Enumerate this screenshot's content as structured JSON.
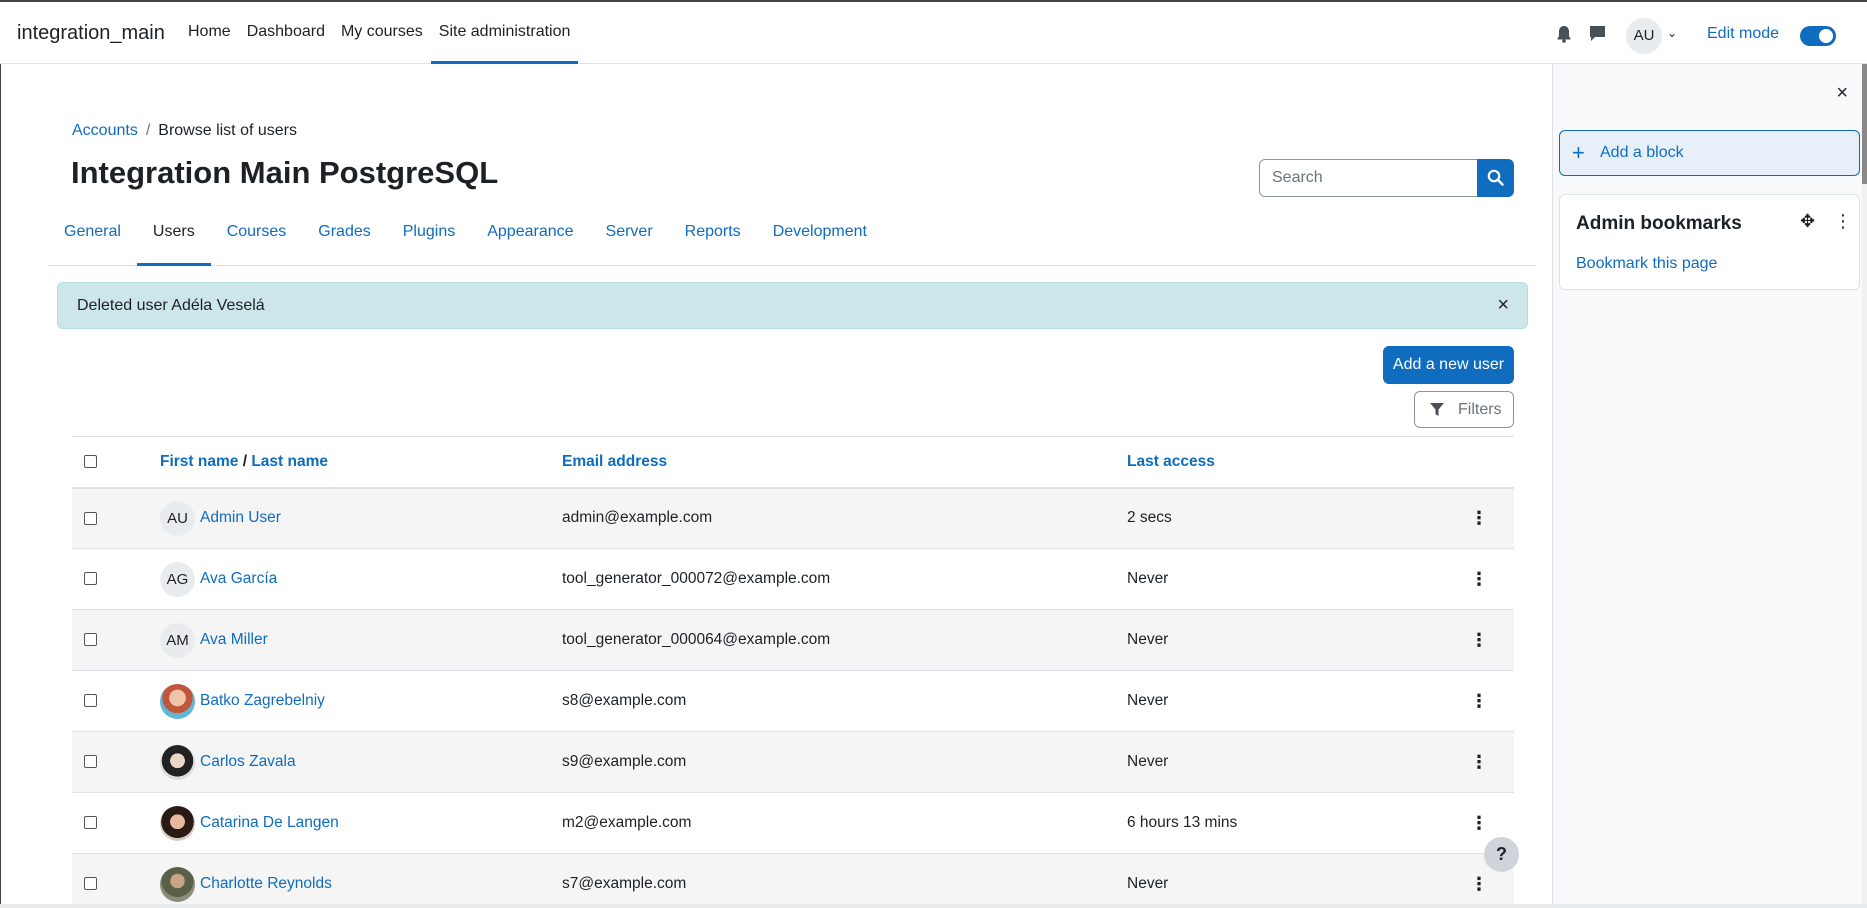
{
  "topbar": {
    "site_name": "integration_main",
    "nav": [
      {
        "label": "Home"
      },
      {
        "label": "Dashboard"
      },
      {
        "label": "My courses"
      },
      {
        "label": "Site administration"
      }
    ],
    "user_initials": "AU",
    "edit_mode_label": "Edit mode",
    "edit_mode_on": true
  },
  "breadcrumb": {
    "parent": "Accounts",
    "current": "Browse list of users"
  },
  "page_title": "Integration Main PostgreSQL",
  "search": {
    "placeholder": "Search"
  },
  "tabs": [
    {
      "label": "General"
    },
    {
      "label": "Users"
    },
    {
      "label": "Courses"
    },
    {
      "label": "Grades"
    },
    {
      "label": "Plugins"
    },
    {
      "label": "Appearance"
    },
    {
      "label": "Server"
    },
    {
      "label": "Reports"
    },
    {
      "label": "Development"
    }
  ],
  "alert": {
    "message": "Deleted user Adéla Veselá",
    "close": "×"
  },
  "actions": {
    "add_user": "Add a new user",
    "filters": "Filters"
  },
  "table": {
    "headers": {
      "first_name": "First name",
      "separator": "/",
      "last_name": "Last name",
      "email": "Email address",
      "last_access": "Last access"
    },
    "rows": [
      {
        "initials": "AU",
        "name": "Admin User",
        "email": "admin@example.com",
        "last_access": "2 secs"
      },
      {
        "initials": "AG",
        "name": "Ava García",
        "email": "tool_generator_000072@example.com",
        "last_access": "Never"
      },
      {
        "initials": "AM",
        "name": "Ava Miller",
        "email": "tool_generator_000064@example.com",
        "last_access": "Never"
      },
      {
        "initials": "",
        "name": "Batko Zagrebelniy",
        "email": "s8@example.com",
        "last_access": "Never"
      },
      {
        "initials": "",
        "name": "Carlos Zavala",
        "email": "s9@example.com",
        "last_access": "Never"
      },
      {
        "initials": "",
        "name": "Catarina De Langen",
        "email": "m2@example.com",
        "last_access": "6 hours 13 mins"
      },
      {
        "initials": "",
        "name": "Charlotte Reynolds",
        "email": "s7@example.com",
        "last_access": "Never"
      }
    ]
  },
  "drawer": {
    "close": "×",
    "add_block": "Add a block",
    "block_title": "Admin bookmarks",
    "bookmark_link": "Bookmark this page"
  },
  "help": "?",
  "colors": {
    "accent": "#0f6cbf",
    "alert_bg": "#cce6ea"
  }
}
